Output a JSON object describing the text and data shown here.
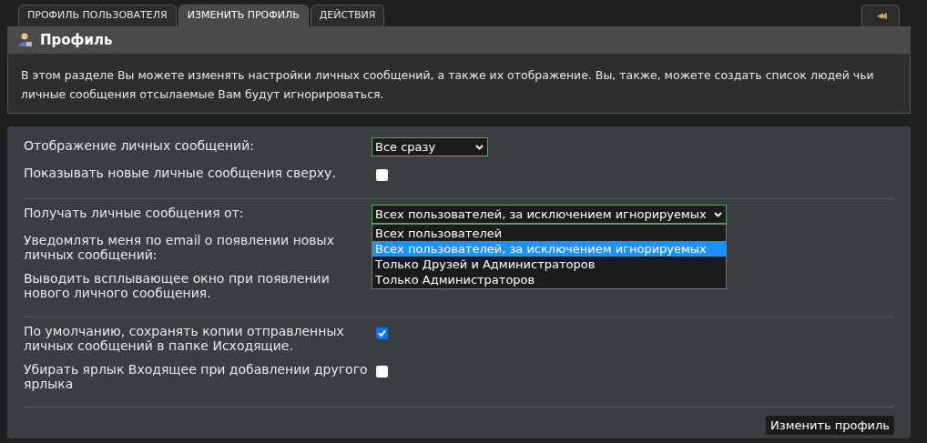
{
  "tabs": [
    {
      "label": "ПРОФИЛЬ ПОЛЬЗОВАТЕЛЯ",
      "selected": false
    },
    {
      "label": "ИЗМЕНИТЬ ПРОФИЛЬ",
      "selected": true
    },
    {
      "label": "ДЕЙСТВИЯ",
      "selected": false
    }
  ],
  "collapse_button": {
    "label": "◀◀"
  },
  "header": {
    "title": "Профиль"
  },
  "description": "В этом разделе Вы можете изменять настройки личных сообщений, а также их отображение. Вы, также, можете создать список людей чьи личные сообщения отсылаемые Вам будут игнорироваться.",
  "sections": [
    {
      "rows": [
        {
          "kind": "select",
          "label": "Отображение личных сообщений:",
          "value": "Все сразу"
        },
        {
          "kind": "checkbox",
          "label": "Показывать новые личные сообщения сверху.",
          "checked": false
        }
      ]
    },
    {
      "rows": [
        {
          "kind": "select",
          "label": "Получать личные сообщения от:",
          "value": "Всех пользователей, за исключением игнорируемых",
          "expanded": true,
          "options": [
            {
              "label": "Всех пользователей",
              "selected": false
            },
            {
              "label": "Всех пользователей, за исключением игнорируемых",
              "selected": true
            },
            {
              "label": "Только Друзей и Администраторов",
              "selected": false
            },
            {
              "label": "Только Администраторов",
              "selected": false
            }
          ]
        },
        {
          "kind": "hidden",
          "label": "Уведомлять меня по email о появлении новых личных сообщений:"
        },
        {
          "kind": "hidden",
          "label": "Выводить всплывающее окно при появлении нового личного сообщения."
        }
      ]
    },
    {
      "rows": [
        {
          "kind": "checkbox",
          "label": "По умолчанию, сохранять копии отправленных личных сообщений в папке Исходящие.",
          "checked": true
        },
        {
          "kind": "checkbox",
          "label": "Убирать ярлык Входящее при добавлении другого ярлыка",
          "checked": false
        }
      ]
    }
  ],
  "submit_button": {
    "label": "Изменить профиль"
  }
}
